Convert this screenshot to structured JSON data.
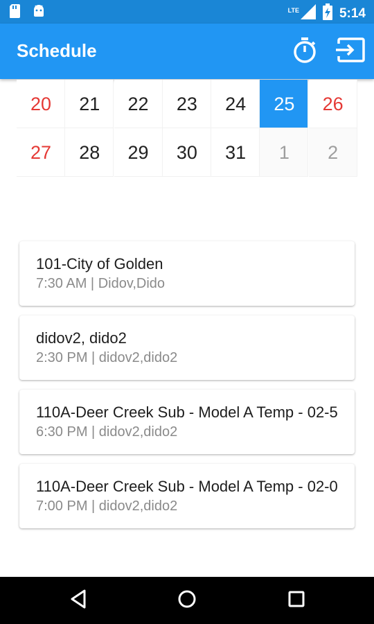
{
  "status_bar": {
    "time": "5:14",
    "network_label": "LTE",
    "icons": [
      "sd-card-icon",
      "android-icon",
      "signal-icon",
      "battery-charging-icon"
    ]
  },
  "app_bar": {
    "title": "Schedule",
    "actions": [
      "timer-icon",
      "logout-icon"
    ],
    "color": "#2196f3"
  },
  "calendar": {
    "selected_day": "25",
    "weeks": [
      [
        {
          "day": "20",
          "type": "weekend"
        },
        {
          "day": "21",
          "type": "normal"
        },
        {
          "day": "22",
          "type": "normal"
        },
        {
          "day": "23",
          "type": "normal"
        },
        {
          "day": "24",
          "type": "normal"
        },
        {
          "day": "25",
          "type": "selected"
        },
        {
          "day": "26",
          "type": "weekend"
        }
      ],
      [
        {
          "day": "27",
          "type": "weekend"
        },
        {
          "day": "28",
          "type": "normal"
        },
        {
          "day": "29",
          "type": "normal"
        },
        {
          "day": "30",
          "type": "normal"
        },
        {
          "day": "31",
          "type": "normal"
        },
        {
          "day": "1",
          "type": "muted"
        },
        {
          "day": "2",
          "type": "muted"
        }
      ]
    ]
  },
  "events": [
    {
      "title": "101-City of Golden",
      "subtitle": "7:30 AM | Didov,Dido"
    },
    {
      "title": "didov2, dido2",
      "subtitle": "2:30 PM | didov2,dido2"
    },
    {
      "title": "110A-Deer Creek Sub - Model A Temp - 02-5",
      "subtitle": "6:30 PM | didov2,dido2"
    },
    {
      "title": "110A-Deer Creek Sub - Model A Temp - 02-0",
      "subtitle": "7:00 PM | didov2,dido2"
    }
  ],
  "nav_bar": {
    "buttons": [
      "back-icon",
      "home-icon",
      "recents-icon"
    ]
  }
}
